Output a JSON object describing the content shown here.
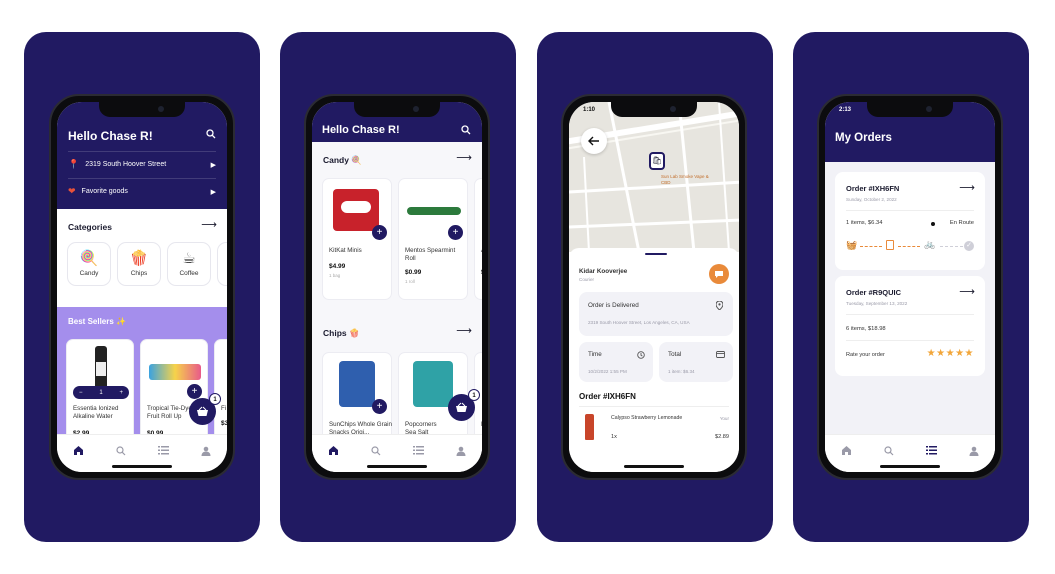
{
  "colors": {
    "navy": "#211A62",
    "lavender": "#A48EEC",
    "orange": "#E98A3A",
    "star": "#F2A63A",
    "map_bg": "#e7e5df"
  },
  "screen1": {
    "greeting": "Hello Chase R!",
    "address": "2319 South Hoover Street",
    "favorites": "Favorite goods",
    "categories_title": "Categories",
    "categories": [
      {
        "label": "Candy",
        "icon": "lollipop-icon"
      },
      {
        "label": "Chips",
        "icon": "popcorn-icon"
      },
      {
        "label": "Coffee",
        "icon": "coffee-icon"
      }
    ],
    "best_sellers_title": "Best Sellers ✨",
    "products": [
      {
        "name": "Essentia Ionized Alkaline Water",
        "price": "$2.99",
        "qty": "1"
      },
      {
        "name": "Tropical Tie-Dye Fruit Roll Up",
        "price": "$0.99"
      },
      {
        "name": "Fi",
        "price": "$3"
      }
    ],
    "cart_count": "1"
  },
  "screen2": {
    "greeting": "Hello Chase R!",
    "candy_title": "Candy 🍭",
    "candy": [
      {
        "name": "KitKat Minis",
        "price": "$4.99",
        "unit": "1 bag"
      },
      {
        "name": "Mentos Spearmint Roll",
        "price": "$0.99",
        "unit": "1 roll"
      },
      {
        "name": "Ai",
        "price": "$2"
      }
    ],
    "chips_title": "Chips 🍿",
    "chips": [
      {
        "name": "SunChips Whole Grain Snacks Origi...",
        "price": ""
      },
      {
        "name": "Popcorners Sea Salt",
        "price": ""
      },
      {
        "name": "Ru",
        "price": ""
      }
    ],
    "cart_count": "1"
  },
  "screen3": {
    "time": "1:10",
    "courier_name": "Kidar Kooverjee",
    "courier_role": "Courier",
    "map_label": "Sun Lab Smoke Vape & CBD",
    "status_title": "Order is Delivered",
    "status_address": "2319 South Hoover Street, Los Angeles, CA, USA",
    "time_label": "Time",
    "time_value": "10/2/2022 1:55 PM",
    "total_label": "Total",
    "total_value": "1 item: $6.34",
    "order_title": "Order #IXH6FN",
    "item_name": "Calypso Strawberry Lemonade",
    "item_qty": "1x",
    "item_price": "$2.89",
    "item_note": "Your"
  },
  "screen4": {
    "time": "2:13",
    "title": "My Orders",
    "orders": [
      {
        "id": "Order #IXH6FN",
        "date": "Sunday, October 2, 2022",
        "summary": "1 items, $6.34",
        "status": "En Route"
      },
      {
        "id": "Order #R9QUIC",
        "date": "Tuesday, September 13, 2022",
        "summary": "6 items, $18.98",
        "rate_label": "Rate your order",
        "rating": 5
      }
    ]
  },
  "tabs": [
    "home-icon",
    "search-icon",
    "list-icon",
    "profile-icon"
  ]
}
